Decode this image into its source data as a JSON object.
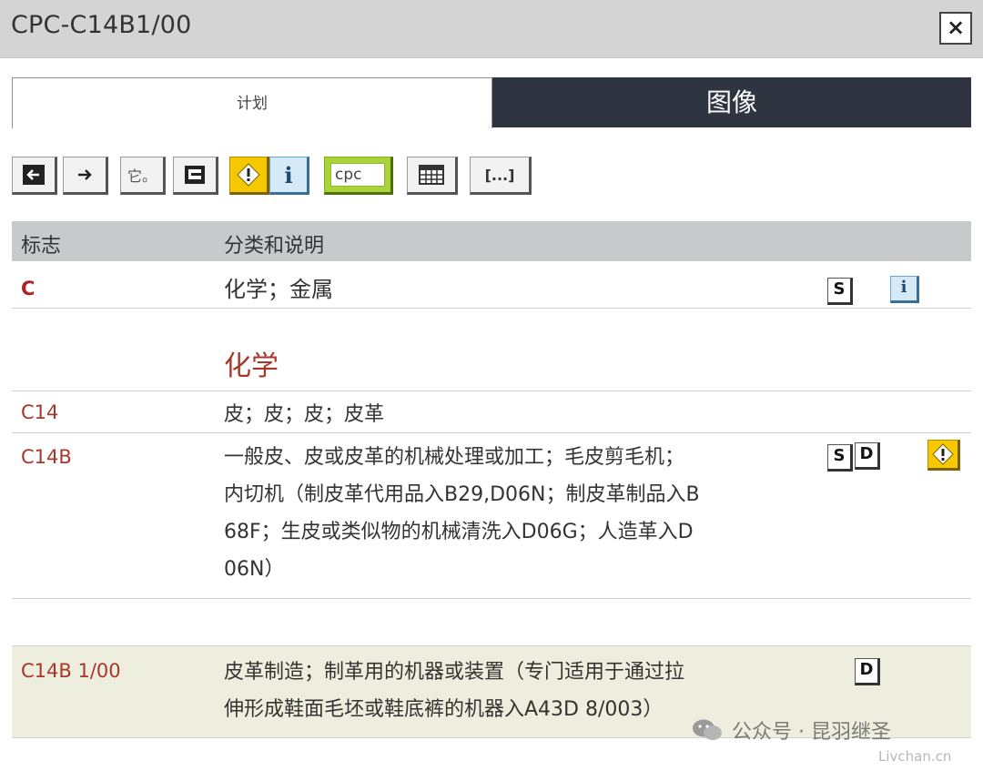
{
  "window": {
    "title": "CPC-C14B1/00",
    "close_label": "×"
  },
  "tabs": [
    {
      "label": "计划",
      "active": true
    },
    {
      "label": "图像",
      "active": false
    }
  ],
  "toolbar": {
    "buttons": [
      {
        "name": "back",
        "icon": "arrow-left-box-icon"
      },
      {
        "name": "forward",
        "icon": "arrow-right-icon"
      },
      {
        "name": "text-toggle",
        "label": "它。"
      },
      {
        "name": "outline",
        "icon": "outline-icon"
      },
      {
        "name": "warning",
        "icon": "warning-icon"
      },
      {
        "name": "info",
        "icon": "info-icon"
      },
      {
        "name": "cpc",
        "label": "cpc"
      },
      {
        "name": "table",
        "icon": "table-grid-icon"
      },
      {
        "name": "ellipsis",
        "label": "[...]"
      }
    ]
  },
  "table": {
    "headers": {
      "symbol": "标志",
      "description": "分类和说明"
    },
    "rows": [
      {
        "code": "C",
        "description": "化学；金属",
        "icons": [
          "s-icon",
          "info-icon"
        ]
      },
      {
        "section_title": "化学"
      },
      {
        "code": "C14",
        "description": "皮；皮；皮；皮革"
      },
      {
        "code": "C14B",
        "description_lines": [
          "一般皮、皮或皮革的机械处理或加工；毛皮剪毛机；",
          "内切机（制皮革代用品入B29,D06N；制皮革制品入B",
          "68F；生皮或类似物的机械清洗入D06G；人造革入D",
          "06N）"
        ],
        "icons": [
          "s-icon",
          "d-icon",
          "warning-icon"
        ]
      },
      {
        "code": "C14B 1/00",
        "description_lines": [
          "皮革制造；制革用的机器或装置（专门适用于通过拉",
          "伸形成鞋面毛坯或鞋底裤的机器入A43D 8/003）"
        ],
        "icons": [
          "d-icon"
        ],
        "highlighted": true
      }
    ]
  },
  "icon_labels": {
    "s": "S",
    "d": "D",
    "i": "i"
  },
  "watermark": {
    "text": "公众号 · 昆羽继圣",
    "small": "Livchan.cn"
  },
  "colors": {
    "code_red": "#a8372a",
    "tab_dark": "#2f3540",
    "header_gray": "#c8c9cb",
    "highlight_row": "#eeeedf",
    "warn_yellow": "#f6c800",
    "cpc_green": "#a8d33a"
  }
}
